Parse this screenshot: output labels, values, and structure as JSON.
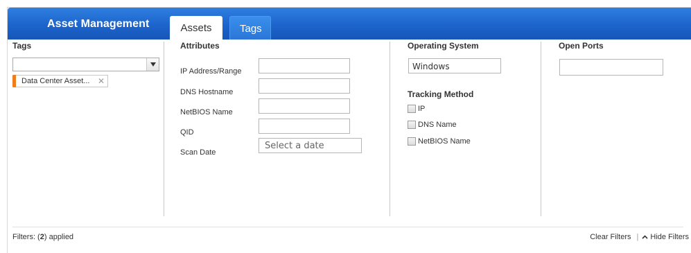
{
  "header": {
    "app_title": "Asset Management",
    "tabs": [
      {
        "label": "Assets",
        "active": true
      },
      {
        "label": "Tags",
        "active": false
      }
    ],
    "accent_color": "#1c64cc"
  },
  "tags_section": {
    "heading": "Tags",
    "select_value": "",
    "chips": [
      {
        "label": "Data Center Asset...",
        "color": "#f07c1b"
      }
    ]
  },
  "attributes_section": {
    "heading": "Attributes",
    "fields": [
      {
        "label": "IP Address/Range",
        "value": ""
      },
      {
        "label": "DNS Hostname",
        "value": ""
      },
      {
        "label": "NetBIOS Name",
        "value": ""
      },
      {
        "label": "QID",
        "value": ""
      }
    ],
    "scan_date": {
      "label": "Scan Date",
      "placeholder": "Select a date"
    }
  },
  "os_section": {
    "heading": "Operating System",
    "value": "Windows",
    "tracking": {
      "heading": "Tracking Method",
      "options": [
        {
          "label": "IP",
          "checked": false
        },
        {
          "label": "DNS Name",
          "checked": false
        },
        {
          "label": "NetBIOS Name",
          "checked": false
        }
      ]
    }
  },
  "ports_section": {
    "heading": "Open Ports",
    "value": ""
  },
  "footer": {
    "filters_prefix": "Filters: (",
    "filters_count": "2",
    "filters_suffix": ") applied",
    "clear_filters": "Clear Filters",
    "separator": "|",
    "hide_filters": "Hide Filters"
  }
}
